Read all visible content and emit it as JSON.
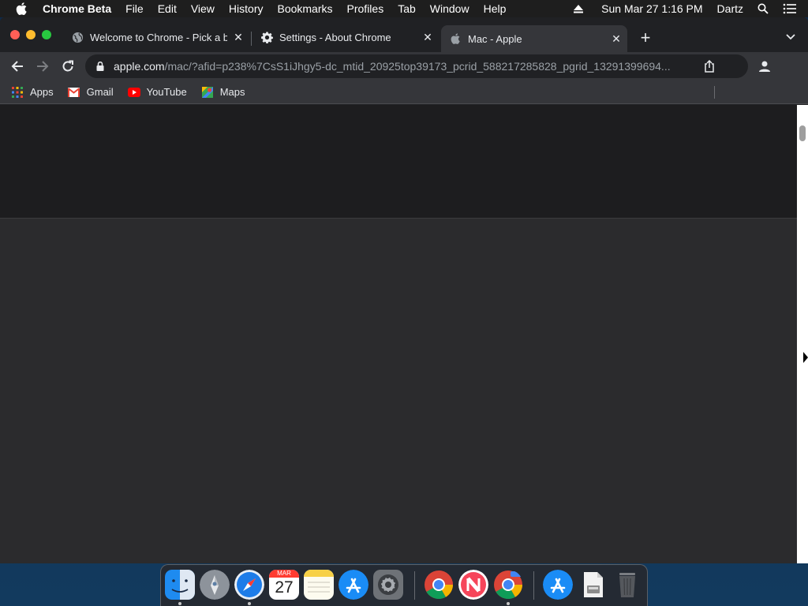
{
  "menubar": {
    "app_name": "Chrome Beta",
    "items": [
      "File",
      "Edit",
      "View",
      "History",
      "Bookmarks",
      "Profiles",
      "Tab",
      "Window",
      "Help"
    ],
    "datetime": "Sun Mar 27  1:16 PM",
    "user": "Dartz"
  },
  "tabs": [
    {
      "title": "Welcome to Chrome - Pick a ba",
      "icon": "globe-icon"
    },
    {
      "title": "Settings - About Chrome",
      "icon": "gear-icon"
    },
    {
      "title": "Mac - Apple",
      "icon": "apple-icon",
      "active": true
    }
  ],
  "omnibox": {
    "host": "apple.com",
    "path": "/mac/?afid=p238%7CsS1iJhgy5-dc_mtid_20925top39173_pcrid_588217285828_pgrid_13291399694..."
  },
  "bookmarks": [
    {
      "label": "Apps",
      "icon": "apps-grid-icon"
    },
    {
      "label": "Gmail",
      "icon": "gmail-icon"
    },
    {
      "label": "YouTube",
      "icon": "youtube-icon"
    },
    {
      "label": "Maps",
      "icon": "maps-icon"
    }
  ],
  "dock": {
    "calendar_month": "MAR",
    "calendar_day": "27",
    "apps": [
      "Finder",
      "Launchpad",
      "Safari",
      "Calendar",
      "Notes",
      "App Store",
      "System Preferences",
      "Google Chrome",
      "News",
      "Chrome Beta",
      "App Store Downloads",
      "Disk Image",
      "Trash"
    ]
  },
  "colors": {
    "menubar": "#1e1e1e",
    "tabstrip": "#202124",
    "toolbar": "#35363a",
    "content_band": "#1d1d1f",
    "content_body": "#2b2b2d"
  }
}
